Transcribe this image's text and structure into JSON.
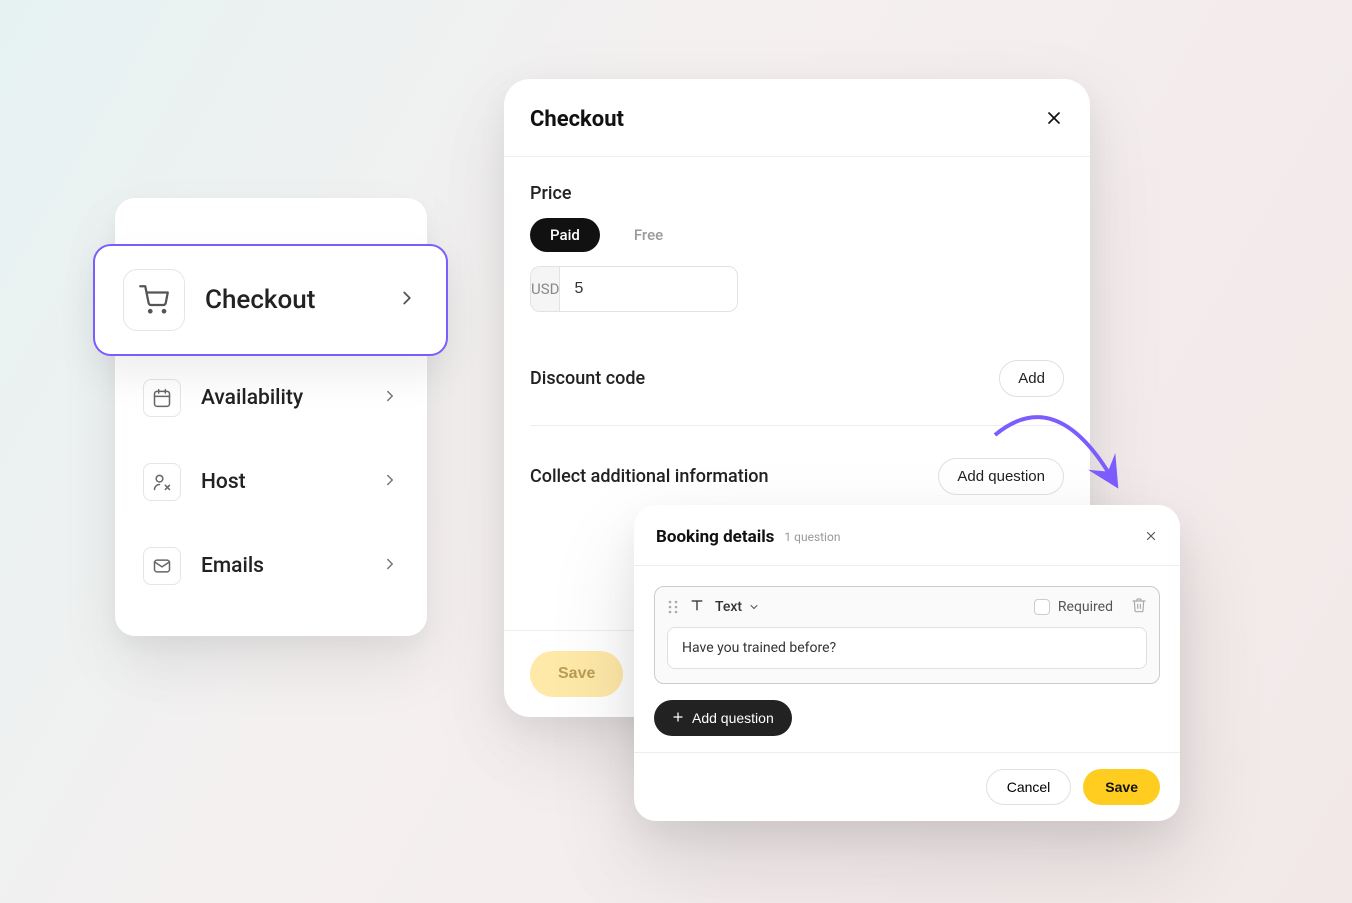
{
  "sidebar": {
    "items": [
      {
        "label": "Checkout",
        "icon": "cart-icon"
      },
      {
        "label": "Availability",
        "icon": "calendar-icon"
      },
      {
        "label": "Host",
        "icon": "user-edit-icon"
      },
      {
        "label": "Emails",
        "icon": "mail-icon"
      }
    ]
  },
  "checkout": {
    "title": "Checkout",
    "price_label": "Price",
    "price_toggle": {
      "paid": "Paid",
      "free": "Free"
    },
    "currency": "USD",
    "price_value": "5",
    "discount_label": "Discount code",
    "discount_add": "Add",
    "collect_label": "Collect additional information",
    "add_question": "Add question",
    "save": "Save"
  },
  "booking": {
    "title": "Booking details",
    "meta": "1 question",
    "question_type": "Text",
    "required_label": "Required",
    "question_text": "Have you trained before?",
    "add_question": "Add question",
    "cancel": "Cancel",
    "save": "Save"
  }
}
